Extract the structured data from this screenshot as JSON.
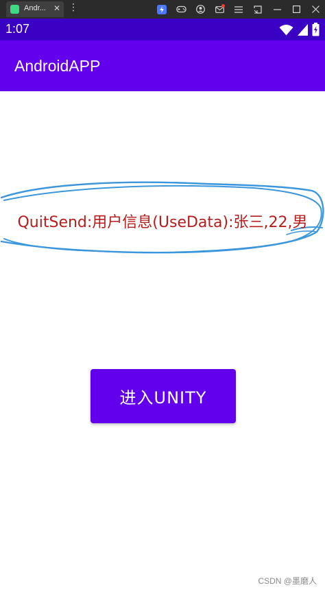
{
  "emulator": {
    "tab_title": "Andr...",
    "tab_close": "✕",
    "menu_glyph": "⋮",
    "tools": [
      "lightning-icon",
      "gamepad-icon",
      "account-icon",
      "mail-icon",
      "menu-icon",
      "screen-icon",
      "minimize-icon",
      "maximize-icon",
      "close-icon"
    ]
  },
  "status_bar": {
    "time": "1:07"
  },
  "app": {
    "title": "AndroidAPP"
  },
  "main": {
    "info_text": "QuitSend:用户信息(UseData):张三,22,男",
    "button_label": "进入UNITY"
  },
  "watermark": "CSDN @墨磨人",
  "colors": {
    "status_bar": "#3a00c4",
    "toolbar": "#6200ee",
    "button": "#6200ee",
    "info_text": "#b71c1c",
    "scribble": "#3b96db"
  }
}
